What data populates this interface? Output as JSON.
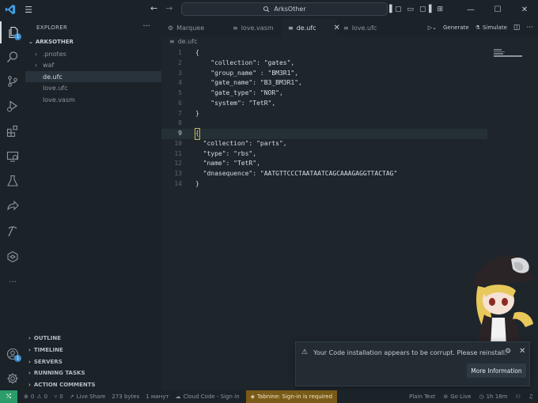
{
  "titlebar": {
    "search_text": "ArksOther",
    "back": "←",
    "forward": "→",
    "menu": "☰",
    "minimize": "—",
    "maximize": "☐",
    "close": "✕"
  },
  "activity": {
    "explorer_badge": "1",
    "accounts_badge": "1",
    "more": "···"
  },
  "sidebar": {
    "title": "EXPLORER",
    "more": "···",
    "root": "ARKSOTHER",
    "tree": [
      {
        "label": ".pnotes",
        "type": "folder",
        "selected": false
      },
      {
        "label": "waf",
        "type": "folder",
        "selected": false
      },
      {
        "label": "de.ufc",
        "type": "file",
        "selected": true
      },
      {
        "label": "love.ufc",
        "type": "file",
        "selected": false
      },
      {
        "label": "love.vasm",
        "type": "file",
        "selected": false
      }
    ],
    "sections": [
      "OUTLINE",
      "TIMELINE",
      "SERVERS",
      "RUNNING TASKS",
      "ACTION COMMENTS"
    ]
  },
  "tabs": {
    "items": [
      {
        "label": "Marquee",
        "active": false,
        "icon": "⚙"
      },
      {
        "label": "love.vasm",
        "active": false,
        "icon": "≡"
      },
      {
        "label": "de.ufc",
        "active": true,
        "icon": "≡"
      },
      {
        "label": "love.ufc",
        "active": false,
        "icon": "≡"
      }
    ],
    "close_glyph": "✕",
    "generate_label": "Generate",
    "simulate_label": "Simulate",
    "more": "···"
  },
  "breadcrumb": {
    "file": "de.ufc"
  },
  "editor": {
    "current_line": 9,
    "lines": [
      {
        "n": "1",
        "text": "{"
      },
      {
        "n": "2",
        "text": "    \"collection\": \"gates\","
      },
      {
        "n": "3",
        "text": "    \"group_name\" : \"BM3R1\","
      },
      {
        "n": "4",
        "text": "    \"gate_name\": \"B3_BM3R1\","
      },
      {
        "n": "5",
        "text": "    \"gate_type\": \"NOR\","
      },
      {
        "n": "6",
        "text": "    \"system\": \"TetR\","
      },
      {
        "n": "7",
        "text": "}"
      },
      {
        "n": "8",
        "text": ""
      },
      {
        "n": "9",
        "text": "{"
      },
      {
        "n": "10",
        "text": "  \"collection\": \"parts\","
      },
      {
        "n": "11",
        "text": "  \"type\": \"rbs\","
      },
      {
        "n": "12",
        "text": "  \"name\": \"TetR\","
      },
      {
        "n": "13",
        "text": "  \"dnasequence\": \"AATGTTCCCTAATAATCAGCAAAGAGGTTACTAG\""
      },
      {
        "n": "14",
        "text": "}"
      }
    ]
  },
  "notification": {
    "message": "Your Code installation appears to be corrupt. Please reinstall.",
    "button": "More Information",
    "close": "✕"
  },
  "status": {
    "remote": "⤭",
    "errors": "0",
    "warnings": "0",
    "ports": "0",
    "live_share": "Live Share",
    "bytes": "273 bytes",
    "time_ago": "1 минут",
    "cloud_code": "Cloud Code - Sign in",
    "tabnine": "Tabnine: Sign-in is required",
    "language": "Plain Text",
    "go_live": "Go Live",
    "time_spent": "1h 18m"
  },
  "colors": {
    "background": "#1e262c",
    "chrome": "#1b2329",
    "remote_green": "#2a9d6a",
    "tabnine_bg": "#7a5a18",
    "accent_blue": "#3f8fd0"
  }
}
